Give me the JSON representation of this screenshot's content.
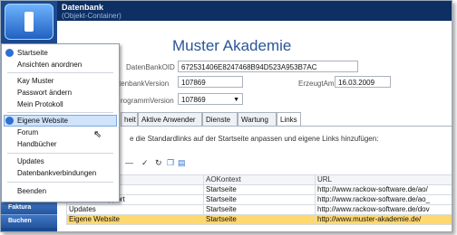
{
  "titlebar": {
    "title": "Datenbank",
    "subtitle": "(Objekt-Container)"
  },
  "sidebar": {
    "nav": [
      "Faktura",
      "Buchen"
    ]
  },
  "page": {
    "heading": "Muster Akademie",
    "fields": {
      "db_oid_label": "DatenBankOID",
      "db_oid_value": "672531406E8247468B94D523A953B7AC",
      "db_version_label": "tenbankVersion",
      "db_version_value": "107869",
      "created_label": "ErzeugtAm",
      "created_value": "16.03.2009",
      "prog_version_label": "rogrammVersion",
      "prog_version_value": "107869"
    },
    "tabs": [
      "heit",
      "Aktive Anwender",
      "Dienste",
      "Wartung",
      "Links"
    ],
    "hint": "e die Standardlinks auf der Startseite anpassen und eigene Links hinzufügen:",
    "toolbar_icons": [
      "remove-icon",
      "check-icon",
      "refresh-icon",
      "copy-icon",
      "paste-icon"
    ],
    "grid": {
      "headers": [
        "",
        "AOKontext",
        "URL"
      ],
      "rows": [
        [
          "",
          "Startseite",
          "http://www.rackow-software.de/ao/"
        ],
        [
          "Hilfe und Support",
          "Startseite",
          "http://www.rackow-software.de/ao_"
        ],
        [
          "Updates",
          "Startseite",
          "http://www.rackow-software.de/dov"
        ],
        [
          "Eigene Website",
          "Startseite",
          "http://www.muster-akademie.de/"
        ]
      ],
      "selected_row": 3
    }
  },
  "menu": {
    "items": [
      "Startseite",
      "Ansichten anordnen",
      "Kay Muster",
      "Passwort ändern",
      "Mein Protokoll",
      "Eigene Website",
      "Forum",
      "Handbücher",
      "Updates",
      "Datenbankverbindungen",
      "Beenden"
    ],
    "highlighted": "Eigene Website"
  },
  "colors": {
    "accent": "#1c4a8f",
    "highlight": "#cfe3fb",
    "selected_row": "#ffd870"
  }
}
